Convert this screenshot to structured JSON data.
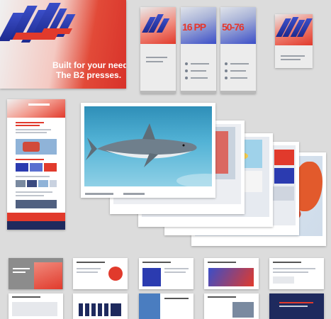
{
  "hero": {
    "line1": "Built for your needs.",
    "line2": "The B2 presses."
  },
  "banners": [
    {
      "headline": "",
      "sub": ""
    },
    {
      "headline": "16 PP",
      "sub": ""
    },
    {
      "headline": "50-76",
      "sub": ""
    },
    {
      "headline": "",
      "sub": ""
    }
  ],
  "colors": {
    "brand_red": "#e13a2c",
    "brand_blue": "#2b3bb0",
    "navy": "#1e2a5e",
    "background": "#dcdcdc"
  }
}
